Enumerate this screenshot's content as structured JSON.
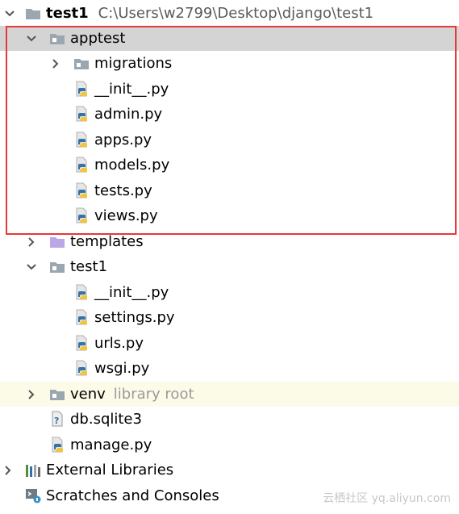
{
  "tree": {
    "root": {
      "label": "test1",
      "path": "C:\\Users\\w2799\\Desktop\\django\\test1"
    },
    "apptest": {
      "label": "apptest",
      "children": [
        "migrations",
        "__init__.py",
        "admin.py",
        "apps.py",
        "models.py",
        "tests.py",
        "views.py"
      ]
    },
    "templates": {
      "label": "templates"
    },
    "test1_pkg": {
      "label": "test1",
      "children": [
        "__init__.py",
        "settings.py",
        "urls.py",
        "wsgi.py"
      ]
    },
    "venv": {
      "label": "venv",
      "hint": "library root"
    },
    "db": {
      "label": "db.sqlite3"
    },
    "manage": {
      "label": "manage.py"
    },
    "external": {
      "label": "External Libraries"
    },
    "scratches": {
      "label": "Scratches and Consoles"
    }
  },
  "watermark": "云栖社区 yq.aliyun.com",
  "colors": {
    "selection": "#d4d4d4",
    "highlight_box": "#e53935",
    "venv_background": "#fcfbe8",
    "folder": "#9aa7b0",
    "templates_folder": "#b9a7e8",
    "python_blue": "#3572a5",
    "python_yellow": "#f2c53d"
  },
  "icons": {
    "folder": "folder-icon",
    "module_folder": "module-folder-icon",
    "templates_folder": "templates-folder-icon",
    "python_file": "python-file-icon",
    "database_file": "database-file-icon",
    "libraries": "libraries-icon",
    "scratches": "scratches-icon",
    "expanded": "chevron-down-icon",
    "collapsed": "chevron-right-icon"
  }
}
